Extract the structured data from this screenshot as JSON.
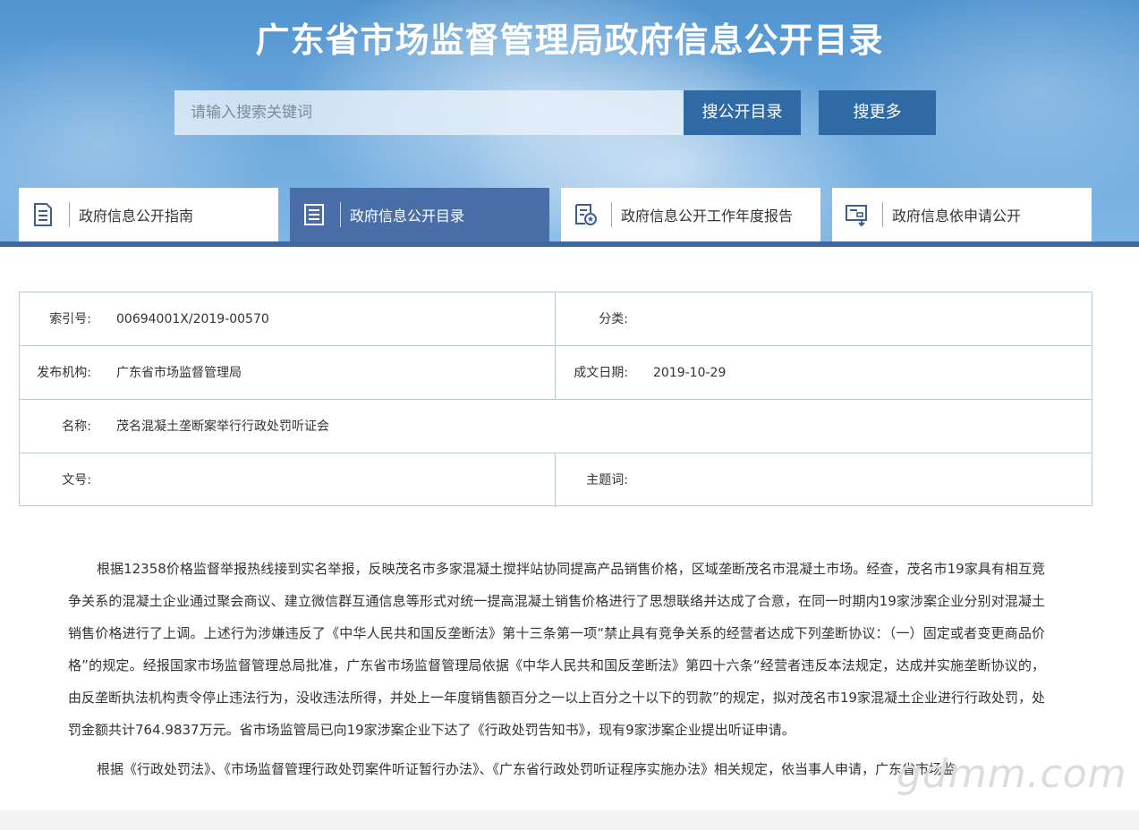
{
  "header": {
    "title": "广东省市场监督管理局政府信息公开目录",
    "search_placeholder": "请输入搜索关键词",
    "btn_catalog": "搜公开目录",
    "btn_more": "搜更多"
  },
  "tabs": [
    {
      "label": "政府信息公开指南",
      "icon": "document-list-icon",
      "active": false
    },
    {
      "label": "政府信息公开目录",
      "icon": "catalog-book-icon",
      "active": true
    },
    {
      "label": "政府信息公开工作年度报告",
      "icon": "report-badge-icon",
      "active": false
    },
    {
      "label": "政府信息依申请公开",
      "icon": "application-download-icon",
      "active": false
    }
  ],
  "info": {
    "index_no_label": "索引号:",
    "index_no": "00694001X/2019-00570",
    "category_label": "分类:",
    "category": "",
    "publisher_label": "发布机构:",
    "publisher": "广东省市场监督管理局",
    "date_label": "成文日期:",
    "date": "2019-10-29",
    "name_label": "名称:",
    "name": "茂名混凝土垄断案举行行政处罚听证会",
    "doc_no_label": "文号:",
    "doc_no": "",
    "keywords_label": "主题词:",
    "keywords": ""
  },
  "content": {
    "p1": "根据12358价格监督举报热线接到实名举报，反映茂名市多家混凝土搅拌站协同提高产品销售价格，区域垄断茂名市混凝土市场。经查，茂名市19家具有相互竞争关系的混凝土企业通过聚会商议、建立微信群互通信息等形式对统一提高混凝土销售价格进行了思想联络并达成了合意，在同一时期内19家涉案企业分别对混凝土销售价格进行了上调。上述行为涉嫌违反了《中华人民共和国反垄断法》第十三条第一项“禁止具有竞争关系的经营者达成下列垄断协议：（一）固定或者变更商品价格”的规定。经报国家市场监督管理总局批准，广东省市场监督管理局依据《中华人民共和国反垄断法》第四十六条“经营者违反本法规定，达成并实施垄断协议的，由反垄断执法机构责令停止违法行为，没收违法所得，并处上一年度销售额百分之一以上百分之十以下的罚款”的规定，拟对茂名市19家混凝土企业进行行政处罚，处罚金额共计764.9837万元。省市场监管局已向19家涉案企业下达了《行政处罚告知书》，现有9家涉案企业提出听证申请。",
    "p2": "根据《行政处罚法》、《市场监督管理行政处罚案件听证暂行办法》、《广东省行政处罚听证程序实施办法》相关规定，依当事人申请，广东省市场监"
  },
  "watermark": "gdmm.com"
}
